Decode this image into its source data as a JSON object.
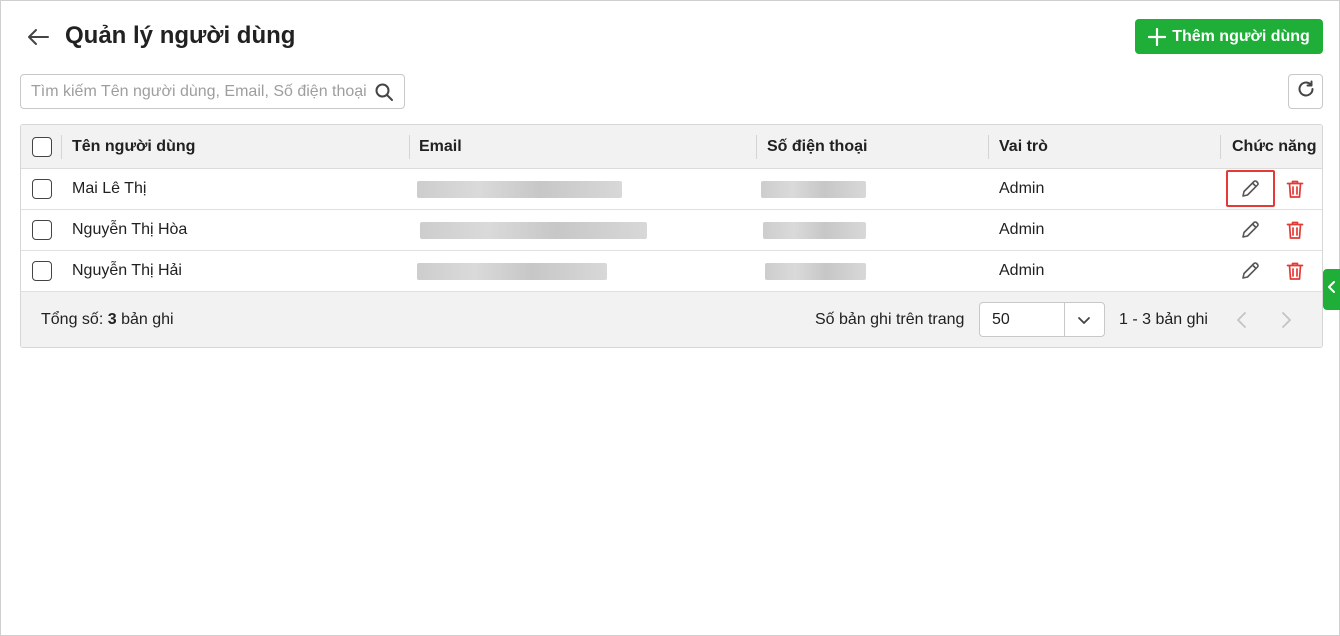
{
  "header": {
    "title": "Quản lý người dùng",
    "add_button_label": "Thêm người dùng"
  },
  "search": {
    "placeholder": "Tìm kiếm Tên người dùng, Email, Số điện thoại",
    "value": ""
  },
  "table": {
    "columns": {
      "name": "Tên người dùng",
      "email": "Email",
      "phone": "Số điện thoại",
      "role": "Vai trò",
      "actions": "Chức năng"
    },
    "rows": [
      {
        "name": "Mai Lê Thị",
        "email": "",
        "phone": "",
        "role": "Admin"
      },
      {
        "name": "Nguyễn Thị Hòa",
        "email": "",
        "phone": "",
        "role": "Admin"
      },
      {
        "name": "Nguyễn Thị Hải",
        "email": "",
        "phone": "",
        "role": "Admin"
      }
    ]
  },
  "footer": {
    "total_prefix": "Tổng số:",
    "total_count": "3",
    "total_suffix": "bản ghi",
    "per_page_label": "Số bản ghi trên trang",
    "per_page_value": "50",
    "range_text": "1 - 3 bản ghi"
  },
  "colors": {
    "accent": "#1faf38",
    "delete": "#e53935",
    "highlight": "#e53935",
    "header_bg": "#f2f2f2"
  },
  "icons": {
    "back": "arrow-left-icon",
    "add": "plus-icon",
    "search": "search-icon",
    "refresh": "refresh-icon",
    "edit": "pencil-icon",
    "delete": "trash-icon",
    "dropdown": "chevron-down-icon",
    "prev": "chevron-left-icon",
    "next": "chevron-right-icon",
    "side_toggle": "chevron-left-icon"
  }
}
